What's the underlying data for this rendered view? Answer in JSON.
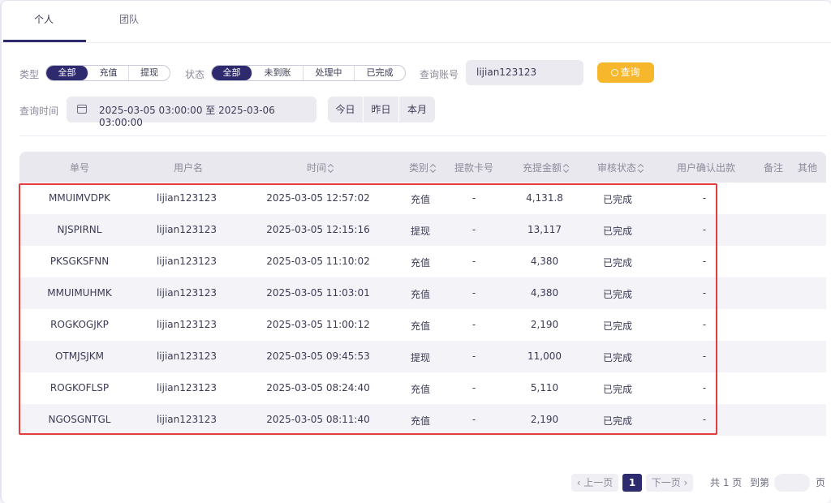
{
  "tabs": [
    {
      "label": "个人"
    },
    {
      "label": "团队"
    }
  ],
  "filters": {
    "type_label": "类型",
    "type_options": [
      "全部",
      "充值",
      "提现"
    ],
    "status_label": "状态",
    "status_options": [
      "全部",
      "未到账",
      "处理中",
      "已完成"
    ],
    "account_label": "查询账号",
    "account_value": "lijian123123",
    "query_button": "查询",
    "time_label": "查询时间",
    "date_range": "2025-03-05 03:00:00 至 2025-03-06 03:00:00",
    "quick_ranges": [
      "今日",
      "昨日",
      "本月"
    ]
  },
  "table": {
    "columns": [
      "单号",
      "用户名",
      "时间",
      "类别",
      "提款卡号",
      "充提金额",
      "审核状态",
      "用户确认出款",
      "备注",
      "其他"
    ],
    "rows": [
      {
        "id": "MMUIMVDPK",
        "user": "lijian123123",
        "time": "2025-03-05 12:57:02",
        "type": "充值",
        "card": "-",
        "amount": "4,131.8",
        "status": "已完成",
        "confirm": "-"
      },
      {
        "id": "NJSPIRNL",
        "user": "lijian123123",
        "time": "2025-03-05 12:15:16",
        "type": "提现",
        "card": "-",
        "amount": "13,117",
        "status": "已完成",
        "confirm": "-"
      },
      {
        "id": "PKSGKSFNN",
        "user": "lijian123123",
        "time": "2025-03-05 11:10:02",
        "type": "充值",
        "card": "-",
        "amount": "4,380",
        "status": "已完成",
        "confirm": "-"
      },
      {
        "id": "MMUIMUHMK",
        "user": "lijian123123",
        "time": "2025-03-05 11:03:01",
        "type": "充值",
        "card": "-",
        "amount": "4,380",
        "status": "已完成",
        "confirm": "-"
      },
      {
        "id": "ROGKOGJKP",
        "user": "lijian123123",
        "time": "2025-03-05 11:00:12",
        "type": "充值",
        "card": "-",
        "amount": "2,190",
        "status": "已完成",
        "confirm": "-"
      },
      {
        "id": "OTMJSJKM",
        "user": "lijian123123",
        "time": "2025-03-05 09:45:53",
        "type": "提现",
        "card": "-",
        "amount": "11,000",
        "status": "已完成",
        "confirm": "-"
      },
      {
        "id": "ROGKOFLSP",
        "user": "lijian123123",
        "time": "2025-03-05 08:24:40",
        "type": "充值",
        "card": "-",
        "amount": "5,110",
        "status": "已完成",
        "confirm": "-"
      },
      {
        "id": "NGOSGNTGL",
        "user": "lijian123123",
        "time": "2025-03-05 08:11:40",
        "type": "充值",
        "card": "-",
        "amount": "2,190",
        "status": "已完成",
        "confirm": "-"
      }
    ]
  },
  "pagination": {
    "prev": "‹ 上一页",
    "current": "1",
    "next": "下一页 ›",
    "total": "共 1 页",
    "goto": "到第",
    "page_unit": "页"
  },
  "colors": {
    "accent": "#2d2a6e",
    "query_button": "#f7b72c",
    "highlight_border": "#e53d3d"
  }
}
